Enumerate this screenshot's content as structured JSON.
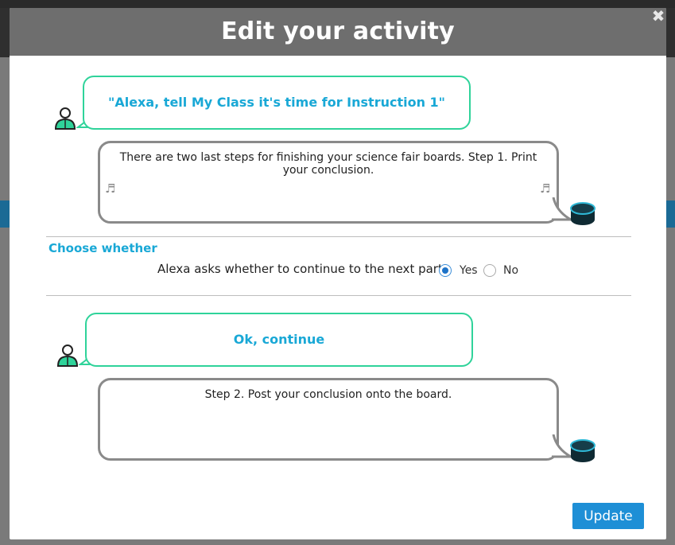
{
  "modal": {
    "title": "Edit your activity",
    "close_icon": "close-icon",
    "update_label": "Update"
  },
  "first_exchange": {
    "user_phrase": "\"Alexa, tell My Class it's time for  Instruction 1\"",
    "alexa_response": "There are two last steps for finishing your science fair boards. Step 1. Print your conclusion."
  },
  "choice": {
    "section_title": "Choose whether",
    "question": "Alexa asks whether to continue to the next part",
    "options": [
      "Yes",
      "No"
    ],
    "selected": "Yes"
  },
  "second_exchange": {
    "user_phrase": "Ok, continue",
    "alexa_response": "Step 2. Post your conclusion onto the board."
  },
  "colors": {
    "accent_blue": "#19a8d6",
    "user_bubble_border": "#2fd39a",
    "alexa_bubble_border": "#8a8a8a",
    "header_bg": "#6e6e6e",
    "button_bg": "#1e8fd6"
  }
}
